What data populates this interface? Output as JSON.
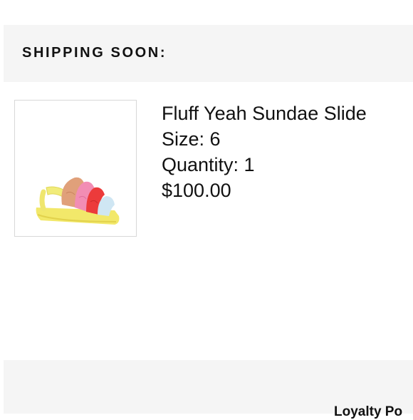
{
  "shipping": {
    "title": "SHIPPING SOON:"
  },
  "product": {
    "image_icon": "sandal-product-image",
    "name": "Fluff Yeah Sundae Slide",
    "size": "Size: 6",
    "quantity": "Quantity: 1",
    "price": "$100.00"
  },
  "footer": {
    "label": "Loyalty Po"
  },
  "colors": {
    "band_bg": "#f5f5f5",
    "text": "#111111",
    "thumb_border": "#d8d8d8"
  }
}
